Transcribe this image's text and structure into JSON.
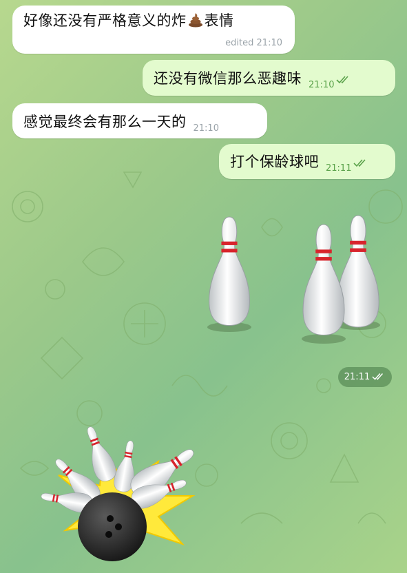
{
  "chat": {
    "messages": [
      {
        "direction": "incoming",
        "text_before_emoji": "好像还没有严格意义的炸",
        "emoji": "pile-of-poo",
        "text_after_emoji": "表情",
        "edited_label": "edited",
        "time": "21:10"
      },
      {
        "direction": "outgoing",
        "text": "还没有微信那么恶趣味",
        "time": "21:10",
        "status": "read"
      },
      {
        "direction": "incoming",
        "text": "感觉最终会有那么一天的",
        "time": "21:10"
      },
      {
        "direction": "outgoing",
        "text": "打个保龄球吧",
        "time": "21:11",
        "status": "read"
      }
    ],
    "sticker": {
      "emoji": "bowling",
      "time": "21:11",
      "status": "read"
    }
  },
  "colors": {
    "wallpaper_start": "#b7d88e",
    "wallpaper_end": "#88c28d",
    "incoming_bubble": "#ffffff",
    "outgoing_bubble": "#e3fbce",
    "outgoing_meta": "#5aa24a",
    "incoming_meta": "#9aa3a9",
    "pin_stripe": "#d8242c",
    "ball": "#2b2b2b"
  }
}
